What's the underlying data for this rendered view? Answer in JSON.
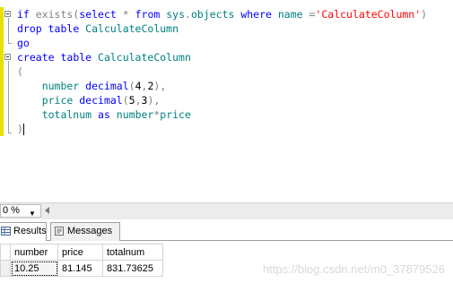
{
  "editor": {
    "lines": [
      {
        "id": "l1",
        "tokens": [
          {
            "t": "if ",
            "c": "kw"
          },
          {
            "t": "exists",
            "c": "gray"
          },
          {
            "t": "(",
            "c": "gray"
          },
          {
            "t": "select ",
            "c": "kw"
          },
          {
            "t": "* ",
            "c": "gray"
          },
          {
            "t": "from ",
            "c": "kw"
          },
          {
            "t": "sys",
            "c": "green"
          },
          {
            "t": ".",
            "c": "gray"
          },
          {
            "t": "objects ",
            "c": "green"
          },
          {
            "t": "where ",
            "c": "kw"
          },
          {
            "t": "name ",
            "c": "green"
          },
          {
            "t": "=",
            "c": "gray"
          },
          {
            "t": "'CalculateColumn'",
            "c": "str"
          },
          {
            "t": ")",
            "c": "gray"
          }
        ]
      },
      {
        "id": "l2",
        "tokens": [
          {
            "t": "drop ",
            "c": "kw"
          },
          {
            "t": "table ",
            "c": "kw"
          },
          {
            "t": "CalculateColumn",
            "c": "green"
          }
        ]
      },
      {
        "id": "l3",
        "tokens": [
          {
            "t": "go",
            "c": "kw"
          }
        ]
      },
      {
        "id": "l4",
        "tokens": [
          {
            "t": "create ",
            "c": "kw"
          },
          {
            "t": "table ",
            "c": "kw"
          },
          {
            "t": "CalculateColumn",
            "c": "green"
          }
        ]
      },
      {
        "id": "l5",
        "tokens": [
          {
            "t": "(",
            "c": "gray"
          }
        ]
      },
      {
        "id": "l6",
        "tokens": [
          {
            "t": "    number ",
            "c": "green"
          },
          {
            "t": "decimal",
            "c": "kw"
          },
          {
            "t": "(",
            "c": "gray"
          },
          {
            "t": "4",
            "c": "plain"
          },
          {
            "t": ",",
            "c": "gray"
          },
          {
            "t": "2",
            "c": "plain"
          },
          {
            "t": "),",
            "c": "gray"
          }
        ]
      },
      {
        "id": "l7",
        "tokens": [
          {
            "t": "    price ",
            "c": "green"
          },
          {
            "t": "decimal",
            "c": "kw"
          },
          {
            "t": "(",
            "c": "gray"
          },
          {
            "t": "5",
            "c": "plain"
          },
          {
            "t": ",",
            "c": "gray"
          },
          {
            "t": "3",
            "c": "plain"
          },
          {
            "t": "),",
            "c": "gray"
          }
        ]
      },
      {
        "id": "l8",
        "tokens": [
          {
            "t": "    totalnum ",
            "c": "green"
          },
          {
            "t": "as ",
            "c": "kw"
          },
          {
            "t": "number",
            "c": "green"
          },
          {
            "t": "*",
            "c": "gray"
          },
          {
            "t": "price",
            "c": "green"
          }
        ]
      },
      {
        "id": "l9",
        "tokens": [
          {
            "t": ")",
            "c": "gray"
          }
        ],
        "caret": true
      }
    ]
  },
  "zoom": {
    "value": "0 %",
    "arrow": "▼"
  },
  "tabs": [
    {
      "label": "Results",
      "active": true
    },
    {
      "label": "Messages",
      "active": false
    }
  ],
  "results": {
    "columns": [
      "number",
      "price",
      "totalnum"
    ],
    "rows": [
      [
        "10.25",
        "81.145",
        "831.73625"
      ]
    ]
  },
  "watermark": "https://blog.csdn.net/m0_37879526",
  "colors": {
    "keyword": "#0000ff",
    "identifier": "#008080",
    "string": "#ff0000",
    "operator": "#808080",
    "change_bar": "#e8e000"
  }
}
